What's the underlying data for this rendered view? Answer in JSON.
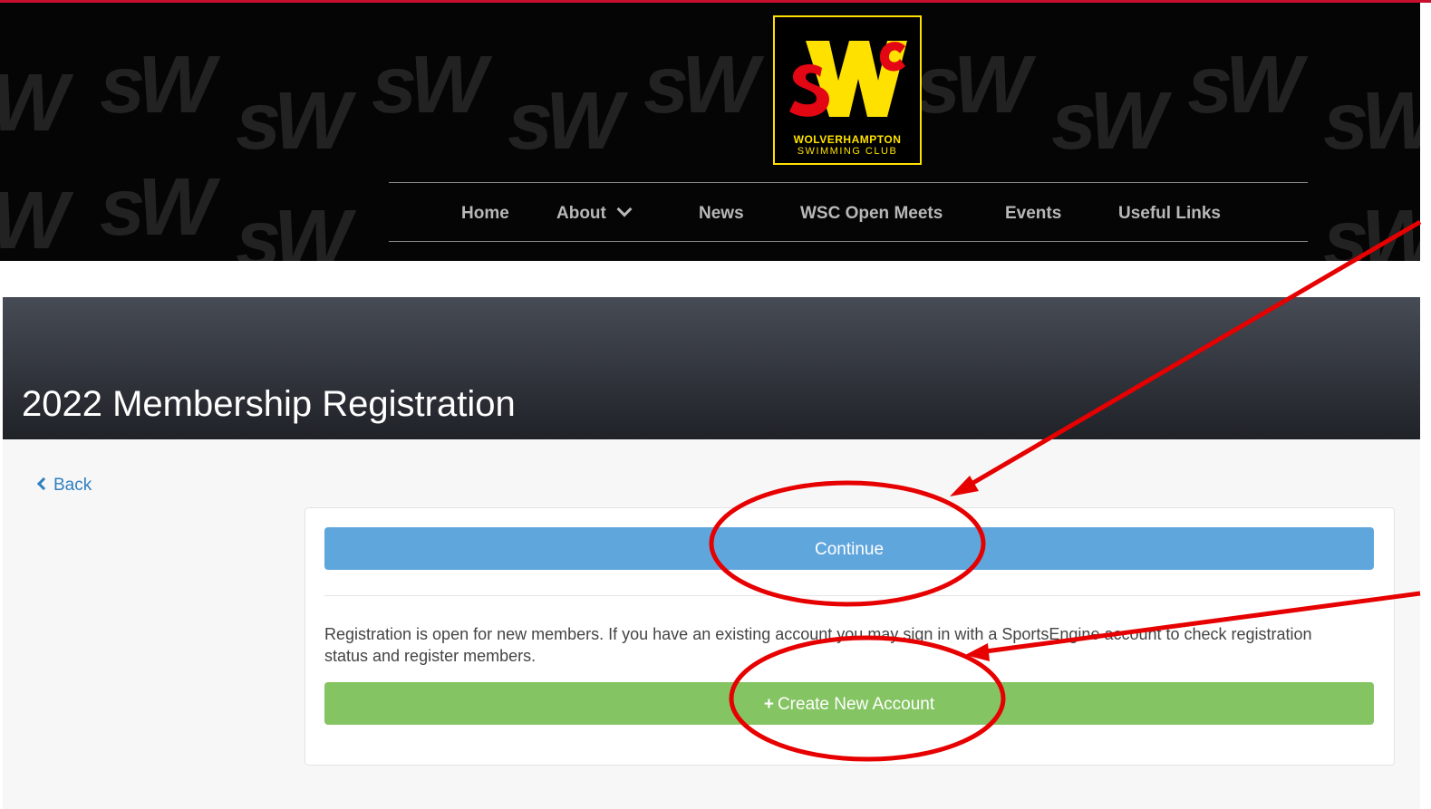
{
  "header": {
    "logo": {
      "mark": "SWC",
      "line1": "WOLVERHAMPTON",
      "line2": "SWIMMING CLUB",
      "accent": "#ffe100",
      "red": "#e30613"
    },
    "nav": [
      {
        "label": "Home"
      },
      {
        "label": "About"
      },
      {
        "label": "News"
      },
      {
        "label": "WSC Open Meets"
      },
      {
        "label": "Events"
      },
      {
        "label": "Useful Links"
      }
    ]
  },
  "page": {
    "title": "2022 Membership Registration"
  },
  "content": {
    "back_label": "Back",
    "continue_label": "Continue",
    "info_text": "Registration is open for new members. If you have an existing account you may sign in with a SportsEngine account to check registration status and register members.",
    "create_label": "Create New Account"
  },
  "annotations": {
    "color": "#e60000",
    "icons": [
      "chevron-down-icon",
      "chevron-left-icon",
      "plus-icon"
    ]
  }
}
